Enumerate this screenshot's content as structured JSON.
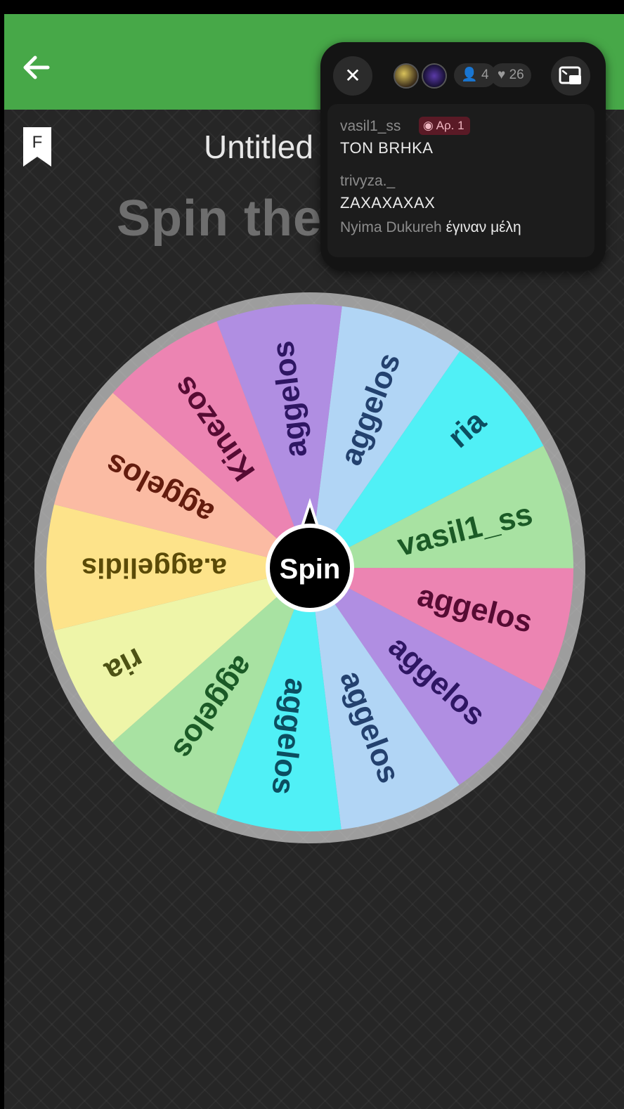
{
  "header": {
    "back_icon": "arrow-left-icon",
    "bar_color": "#47a848"
  },
  "bookmark": {
    "icon": "bookmark-f-icon",
    "letter": "F"
  },
  "wheel": {
    "title": "Untitled",
    "heading": "Spin the",
    "button_label": "Spin",
    "segments": [
      {
        "label": "aggelos",
        "color": "#b1d5f5",
        "text": "#23416e"
      },
      {
        "label": "ria",
        "color": "#50f0f6",
        "text": "#0c4e60"
      },
      {
        "label": "vasil1_ss",
        "color": "#a8e2a2",
        "text": "#1b5a26"
      },
      {
        "label": "aggelos",
        "color": "#ec84b2",
        "text": "#560b33"
      },
      {
        "label": "aggelos",
        "color": "#b08ee2",
        "text": "#2e1663"
      },
      {
        "label": "aggelos",
        "color": "#b1d5f5",
        "text": "#23416e"
      },
      {
        "label": "aggelos",
        "color": "#50f0f6",
        "text": "#0c4e60"
      },
      {
        "label": "aggelos",
        "color": "#a8e2a2",
        "text": "#1b5a26"
      },
      {
        "label": "ria",
        "color": "#eef5a8",
        "text": "#4d5215"
      },
      {
        "label": "a.aggelidis",
        "color": "#fde38a",
        "text": "#5a4a08"
      },
      {
        "label": "aggelos",
        "color": "#fbbba3",
        "text": "#631c0e"
      },
      {
        "label": "Kinezos",
        "color": "#ec84b2",
        "text": "#560b33"
      },
      {
        "label": "aggelos",
        "color": "#b08ee2",
        "text": "#2e1663"
      }
    ]
  },
  "live": {
    "close_icon": "close-icon",
    "pip_icon": "picture-in-picture-icon",
    "viewers": "4",
    "likes": "26",
    "chat": [
      {
        "user": "vasil1_ss",
        "badge": "Αρ. 1",
        "message": "TON BRHKA"
      },
      {
        "user": "trivyza._",
        "message": "ZAXAXAXAX"
      }
    ],
    "join_name": "Nyima Dukureh",
    "join_text": "έγιναν μέλη"
  }
}
